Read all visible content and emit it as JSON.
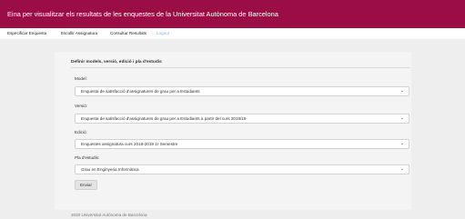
{
  "header": {
    "title": "Eina per visualitzar els resultats de les enquestes de la Universitat Autònoma de Barcelona"
  },
  "nav": {
    "items": [
      {
        "label": "Especificar Enquesta"
      },
      {
        "label": "Escollir Assignatura"
      },
      {
        "label": "Consultar Resultats"
      },
      {
        "label": "Logout"
      }
    ]
  },
  "form": {
    "title": "Definir models, versió, edició i pla d'estudis",
    "fields": [
      {
        "label": "Model:",
        "value": "Enquesta de satisfacció d'assignatures de grau per a Estudiants"
      },
      {
        "label": "Versió:",
        "value": "Enquesta de satisfacció d'assignatures de grau per a Estudiants a partir del curs 2018/19"
      },
      {
        "label": "Edició:",
        "value": "Enquestes assignatura curs 2018-2019 1r Semestre"
      },
      {
        "label": "Pla d'estudis:",
        "value": "Grau en Enginyeria Informàtica"
      }
    ],
    "submit_label": "Enviar"
  },
  "footer": {
    "text": "2020 Universitat Autònoma de Barcelona"
  },
  "colors": {
    "brand": "#9b0e45",
    "active_link": "#8ab4e8"
  },
  "icons": {
    "select_arrow": "chevron-down-icon"
  }
}
